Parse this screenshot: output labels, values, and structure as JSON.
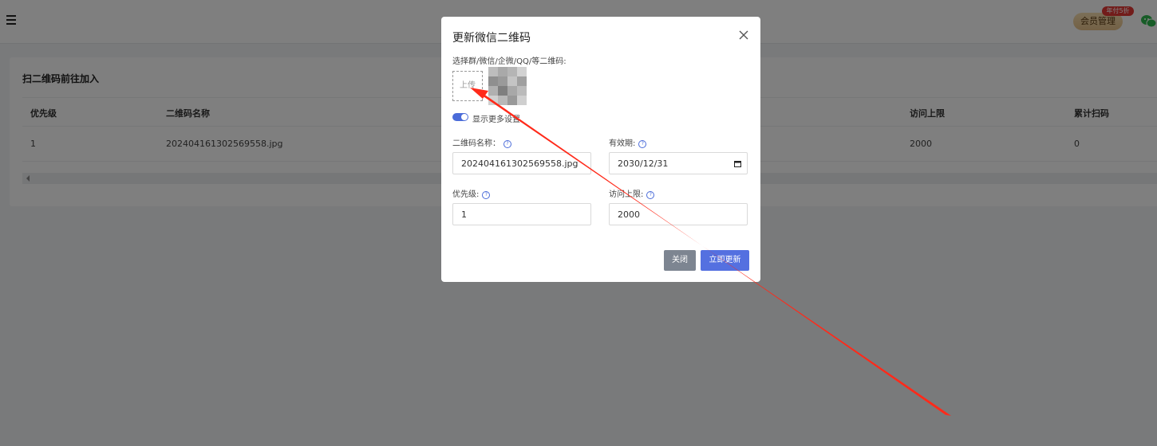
{
  "background": {
    "vip_button": "会员管理",
    "vip_badge": "年付5折",
    "card_title": "扫二维码前往加入",
    "table": {
      "headers": [
        "优先级",
        "二维码名称",
        "访问上限",
        "累计扫码"
      ],
      "row": [
        "1",
        "202404161302569558.jpg",
        "2000",
        "0"
      ]
    }
  },
  "modal": {
    "title": "更新微信二维码",
    "upload_label": "选择群/微信/企微/QQ/等二维码:",
    "upload_button": "上传",
    "toggle_label": "显示更多设置",
    "fields": {
      "name_label": "二维码名称：",
      "name_value": "202404161302569558.jpg",
      "expiry_label": "有效期:",
      "expiry_value": "2030/12/31",
      "priority_label": "优先级:",
      "priority_value": "1",
      "limit_label": "访问上限:",
      "limit_value": "2000"
    },
    "buttons": {
      "close": "关闭",
      "update": "立即更新"
    }
  },
  "colors": {
    "primary": "#5470e0",
    "toggle_on": "#4b6cd9",
    "close_button": "#7d8591",
    "annotation_arrow": "#ff2a1a"
  }
}
